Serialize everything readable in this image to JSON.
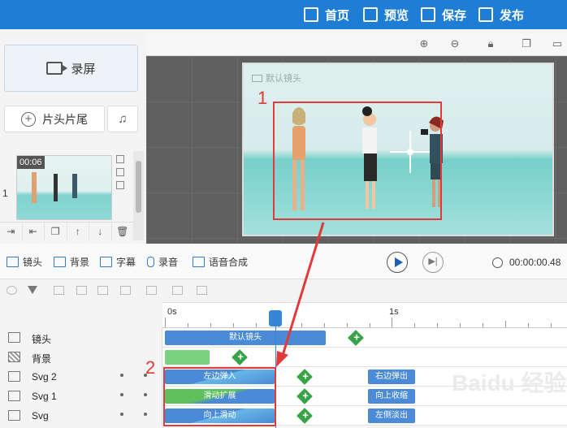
{
  "header": {
    "home_label": "首页",
    "preview_label": "预览",
    "save_label": "保存",
    "publish_label": "发布"
  },
  "left_panel": {
    "record_label": "录屏",
    "head_tail_label": "片头片尾",
    "scene_number": "1",
    "scene_duration": "00:06"
  },
  "canvas": {
    "camera_label": "默认镜头",
    "annotation_1": "1"
  },
  "media_toolbar": {
    "items": [
      "镜头",
      "背景",
      "字幕",
      "录音",
      "语音合成"
    ],
    "time": "00:00:00.48"
  },
  "timeline": {
    "ruler": [
      "0s",
      "1s"
    ],
    "annotation_2": "2",
    "tracks": [
      {
        "name": "镜头",
        "bars": [
          "默认镜头"
        ]
      },
      {
        "name": "背景",
        "bars": []
      },
      {
        "name": "Svg 2",
        "bars": [
          "左边弹入",
          "右边弹出"
        ]
      },
      {
        "name": "Svg 1",
        "bars": [
          "滑动扩展",
          "向上收缩"
        ]
      },
      {
        "name": "Svg",
        "bars": [
          "向上滑动",
          "左侧淡出"
        ]
      }
    ]
  },
  "colors": {
    "accent": "#1e7ed6",
    "annotation_red": "#e03a3a",
    "keyframe_green": "#3aa34a"
  },
  "watermark": "Baidu 经验"
}
